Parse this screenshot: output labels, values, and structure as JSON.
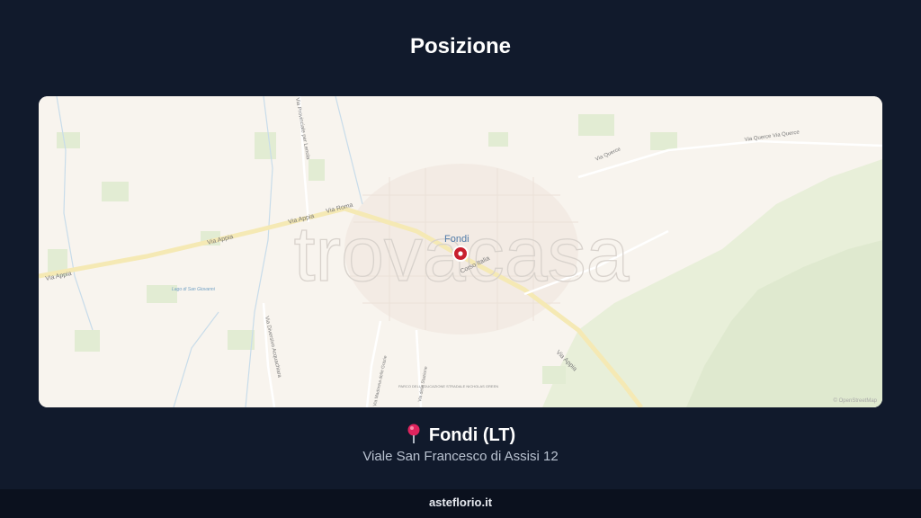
{
  "section": {
    "title": "Posizione"
  },
  "map": {
    "watermark": "trovacasa",
    "attribution": "© OpenStreetMap",
    "town_label": "Fondi",
    "labels": {
      "via_appia_west": "Via Appia",
      "via_appia_mid": "Via Appia",
      "via_roma": "Via Roma",
      "corso_italia": "Corso Italia",
      "via_appia_east": "Via Appia",
      "via_querce_1": "Via Querce",
      "via_querce_2": "Via Querce Via Querce",
      "via_lenola": "Via Provinciale per Lenola",
      "via_diversivo": "Via Diversivo Acquachiara",
      "lago": "Lago di San Giovanni",
      "via_madonna": "Via Madonna delle Grazie",
      "via_stazione": "Via della Stazione",
      "parco": "PARCO DELL'EDUCAZIONE STRADALE NICHOLAS GREEN"
    },
    "marker_color": "#c8202e"
  },
  "location": {
    "pin_icon": "pushpin-icon",
    "name": "Fondi (LT)",
    "address": "Viale San Francesco di Assisi 12"
  },
  "footer": {
    "site": "asteflorio.it"
  }
}
